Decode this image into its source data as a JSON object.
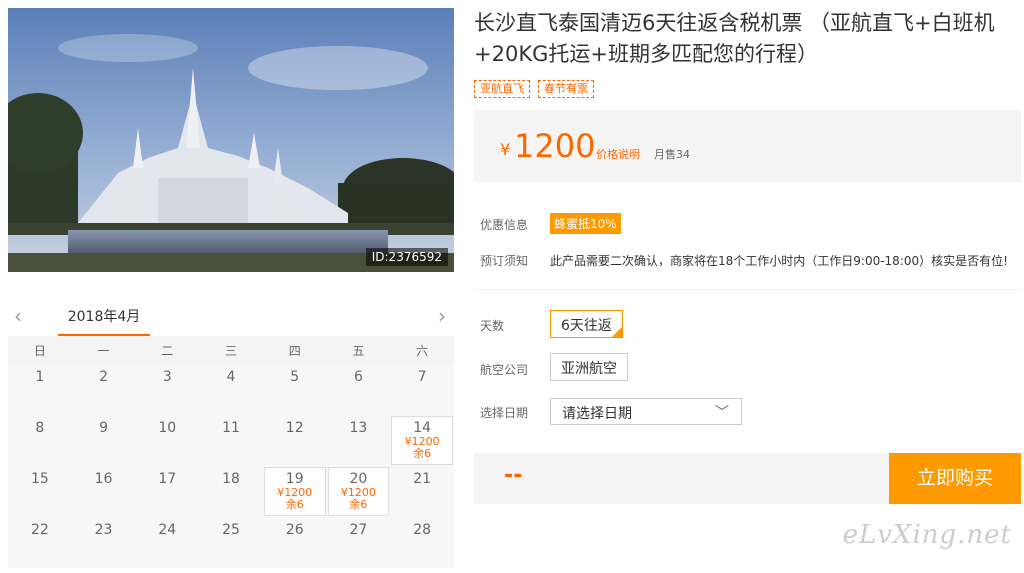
{
  "photo": {
    "id_label": "ID:2376592"
  },
  "calendar": {
    "month_label": "2018年4月",
    "prev_icon": "‹",
    "next_icon": "›",
    "weekdays": [
      "日",
      "一",
      "二",
      "三",
      "四",
      "五",
      "六"
    ],
    "weeks": [
      [
        {
          "day": "1"
        },
        {
          "day": "2"
        },
        {
          "day": "3"
        },
        {
          "day": "4"
        },
        {
          "day": "5"
        },
        {
          "day": "6"
        },
        {
          "day": "7"
        }
      ],
      [
        {
          "day": "8"
        },
        {
          "day": "9"
        },
        {
          "day": "10"
        },
        {
          "day": "11"
        },
        {
          "day": "12"
        },
        {
          "day": "13"
        },
        {
          "day": "14",
          "price": "¥1200",
          "stock": "余6"
        }
      ],
      [
        {
          "day": "15"
        },
        {
          "day": "16"
        },
        {
          "day": "17"
        },
        {
          "day": "18"
        },
        {
          "day": "19",
          "price": "¥1200",
          "stock": "余6"
        },
        {
          "day": "20",
          "price": "¥1200",
          "stock": "余6"
        },
        {
          "day": "21"
        }
      ],
      [
        {
          "day": "22"
        },
        {
          "day": "23"
        },
        {
          "day": "24"
        },
        {
          "day": "25"
        },
        {
          "day": "26"
        },
        {
          "day": "27"
        },
        {
          "day": "28"
        }
      ]
    ]
  },
  "product": {
    "title": "长沙直飞泰国清迈6天往返含税机票 （亚航直飞+白班机+20KG托运+班期多匹配您的行程）",
    "tags": [
      "亚航直飞",
      "春节有票"
    ]
  },
  "price": {
    "currency": "¥",
    "value": "1200",
    "explain_label": "价格说明",
    "monthly_sales": "月售34"
  },
  "info": {
    "discount_label": "优惠信息",
    "discount_badge": "蜂蜜抵10%",
    "notice_label": "预订须知",
    "notice_text": "此产品需要二次确认，商家将在18个工作小时内（工作日9:00-18:00）核实是否有位!"
  },
  "options": {
    "days_label": "天数",
    "days_value": "6天往返",
    "airline_label": "航空公司",
    "airline_value": "亚洲航空",
    "date_label": "选择日期",
    "date_placeholder": "请选择日期",
    "date_chevron": "﹀"
  },
  "buy": {
    "total": "--",
    "button_label": "立即购买"
  },
  "watermark": "eLvXing.net",
  "colors": {
    "accent": "#ff6600",
    "button": "#ff9900"
  }
}
